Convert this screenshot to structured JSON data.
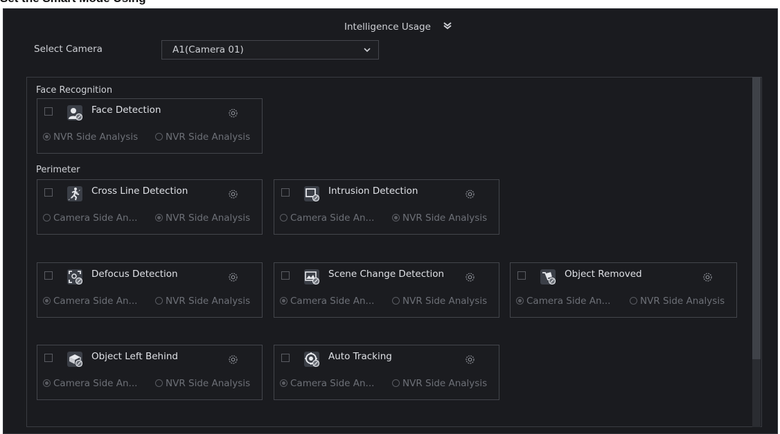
{
  "doc_heading": "Set the Smart Mode Using",
  "header": {
    "title": "Intelligence Usage"
  },
  "camera_select": {
    "label": "Select Camera",
    "value": "A1(Camera 01)"
  },
  "sections": {
    "face_recognition": {
      "label": "Face Recognition"
    },
    "perimeter": {
      "label": "Perimeter"
    }
  },
  "functions": {
    "face_detection": {
      "name": "Face Detection",
      "icon": "face-detection-icon",
      "opt1": "NVR Side Analysis",
      "opt2": "NVR Side Analysis",
      "selected": 1
    },
    "cross_line": {
      "name": "Cross Line Detection",
      "icon": "cross-line-icon",
      "opt1": "Camera Side An...",
      "opt2": "NVR Side Analysis",
      "selected": 2
    },
    "intrusion": {
      "name": "Intrusion Detection",
      "icon": "intrusion-icon",
      "opt1": "Camera Side An...",
      "opt2": "NVR Side Analysis",
      "selected": 2
    },
    "defocus": {
      "name": "Defocus Detection",
      "icon": "defocus-icon",
      "opt1": "Camera Side An...",
      "opt2": "NVR Side Analysis",
      "selected": 1
    },
    "scene_change": {
      "name": "Scene Change Detection",
      "icon": "scene-change-icon",
      "opt1": "Camera Side An...",
      "opt2": "NVR Side Analysis",
      "selected": 1
    },
    "object_removed": {
      "name": "Object Removed",
      "icon": "object-removed-icon",
      "opt1": "Camera Side An...",
      "opt2": "NVR Side Analysis",
      "selected": 1
    },
    "object_left": {
      "name": "Object Left Behind",
      "icon": "object-left-icon",
      "opt1": "Camera Side An...",
      "opt2": "NVR Side Analysis",
      "selected": 1
    },
    "auto_tracking": {
      "name": "Auto Tracking",
      "icon": "auto-tracking-icon",
      "opt1": "Camera Side An...",
      "opt2": "NVR Side Analysis",
      "selected": 1
    }
  },
  "colors": {
    "background": "#1a1b1f",
    "text": "#cfd1d6",
    "muted": "#6d7077",
    "border": "#44464c"
  }
}
